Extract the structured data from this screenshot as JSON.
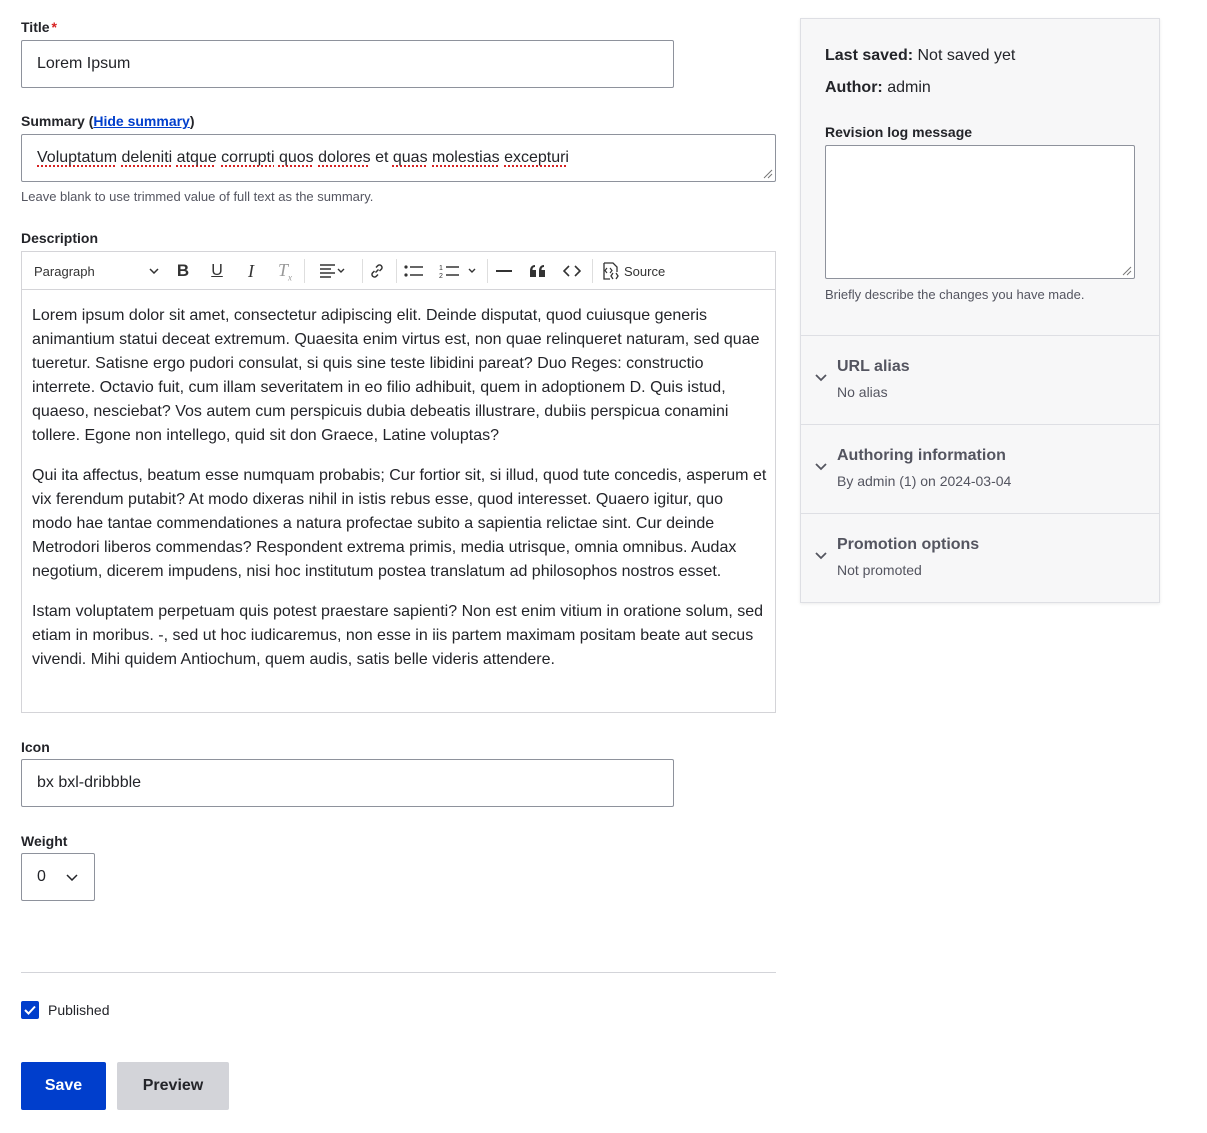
{
  "title_field": {
    "label": "Title",
    "required_mark": "*",
    "value": "Lorem Ipsum"
  },
  "summary_field": {
    "label": "Summary (",
    "toggle_link": "Hide summary",
    "label_close": ")",
    "value_words": [
      "Voluptatum",
      "deleniti",
      "atque",
      "corrupti",
      "quos",
      "dolores",
      "et",
      "quas",
      "molestias",
      "excepturi"
    ],
    "help": "Leave blank to use trimmed value of full text as the summary."
  },
  "description": {
    "label": "Description",
    "toolbar": {
      "paragraph_select": "Paragraph",
      "source_label": "Source",
      "icons": [
        "bold-icon",
        "underline-icon",
        "italic-icon",
        "remove-format-icon",
        "align-icon",
        "link-icon",
        "bulleted-list-icon",
        "numbered-list-icon",
        "horizontal-line-icon",
        "blockquote-icon",
        "code-block-icon",
        "source-icon"
      ]
    },
    "paragraphs": [
      "Lorem ipsum dolor sit amet, consectetur adipiscing elit. Deinde disputat, quod cuiusque generis animantium statui deceat extremum. Quaesita enim virtus est, non quae relinqueret naturam, sed quae tueretur. Satisne ergo pudori consulat, si quis sine teste libidini pareat? Duo Reges: constructio interrete. Octavio fuit, cum illam severitatem in eo filio adhibuit, quem in adoptionem D. Quis istud, quaeso, nesciebat? Vos autem cum perspicuis dubia debeatis illustrare, dubiis perspicua conamini tollere. Egone non intellego, quid sit don Graece, Latine voluptas?",
      "Qui ita affectus, beatum esse numquam probabis; Cur fortior sit, si illud, quod tute concedis, asperum et vix ferendum putabit? At modo dixeras nihil in istis rebus esse, quod interesset. Quaero igitur, quo modo hae tantae commendationes a natura profectae subito a sapientia relictae sint. Cur deinde Metrodori liberos commendas? Respondent extrema primis, media utrisque, omnia omnibus. Audax negotium, dicerem impudens, nisi hoc institutum postea translatum ad philosophos nostros esset.",
      "Istam voluptatem perpetuam quis potest praestare sapienti? Non est enim vitium in oratione solum, sed etiam in moribus. -, sed ut hoc iudicaremus, non esse in iis partem maximam positam beate aut secus vivendi. Mihi quidem Antiochum, quem audis, satis belle videris attendere."
    ]
  },
  "icon_field": {
    "label": "Icon",
    "value": "bx bxl-dribbble"
  },
  "weight_field": {
    "label": "Weight",
    "value": "0"
  },
  "published": {
    "label": "Published",
    "checked": true
  },
  "actions": {
    "save": "Save",
    "preview": "Preview"
  },
  "sidebar": {
    "last_saved_label": "Last saved:",
    "last_saved_value": "Not saved yet",
    "author_label": "Author:",
    "author_value": "admin",
    "revision_label": "Revision log message",
    "revision_value": "",
    "revision_help": "Briefly describe the changes you have made.",
    "sections": [
      {
        "title": "URL alias",
        "summary": "No alias"
      },
      {
        "title": "Authoring information",
        "summary": "By admin (1) on 2024-03-04"
      },
      {
        "title": "Promotion options",
        "summary": "Not promoted"
      }
    ]
  },
  "colors": {
    "primary": "#003ecc",
    "text": "#232429",
    "muted": "#545560",
    "border": "#8e929c",
    "required": "#d72222",
    "secondary_button": "#d3d4d9"
  }
}
